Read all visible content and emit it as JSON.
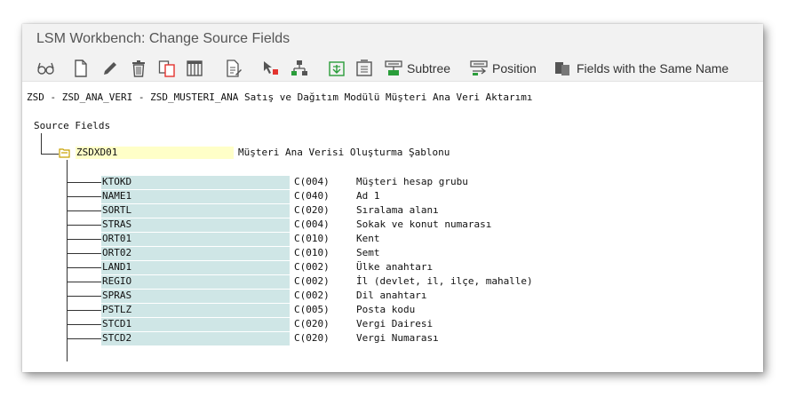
{
  "window": {
    "title": "LSM Workbench: Change Source Fields"
  },
  "toolbar": {
    "items": [
      {
        "icon": "glasses-icon"
      },
      {
        "icon": "new-document-icon"
      },
      {
        "icon": "pencil-icon"
      },
      {
        "icon": "trash-icon"
      },
      {
        "icon": "copy-icon"
      },
      {
        "icon": "table-icon"
      },
      {
        "icon": "document-edit-icon"
      },
      {
        "icon": "cursor-select-icon"
      },
      {
        "icon": "hierarchy-icon"
      },
      {
        "icon": "expand-icon"
      },
      {
        "icon": "collapse-icon"
      }
    ],
    "subtree_label": "Subtree",
    "position_label": "Position",
    "same_name_label": "Fields with the Same Name"
  },
  "header_line": "ZSD - ZSD_ANA_VERI - ZSD_MUSTERI_ANA Satış ve Dağıtım Modülü Müşteri Ana Veri Aktarımı",
  "tree": {
    "root_label": "Source Fields",
    "structure": {
      "name": "ZSDXD01",
      "description": "Müşteri Ana Verisi Oluşturma Şablonu"
    },
    "fields": [
      {
        "name": "KTOKD",
        "type": "C(004)",
        "description": "Müşteri hesap grubu"
      },
      {
        "name": "NAME1",
        "type": "C(040)",
        "description": "Ad 1"
      },
      {
        "name": "SORTL",
        "type": "C(020)",
        "description": "Sıralama alanı"
      },
      {
        "name": "STRAS",
        "type": "C(004)",
        "description": "Sokak ve konut numarası"
      },
      {
        "name": "ORT01",
        "type": "C(010)",
        "description": "Kent"
      },
      {
        "name": "ORT02",
        "type": "C(010)",
        "description": "Semt"
      },
      {
        "name": "LAND1",
        "type": "C(002)",
        "description": "Ülke anahtarı"
      },
      {
        "name": "REGIO",
        "type": "C(002)",
        "description": "İl (devlet, il, ilçe, mahalle)"
      },
      {
        "name": "SPRAS",
        "type": "C(002)",
        "description": "Dil anahtarı"
      },
      {
        "name": "PSTLZ",
        "type": "C(005)",
        "description": "Posta kodu"
      },
      {
        "name": "STCD1",
        "type": "C(020)",
        "description": "Vergi Dairesi"
      },
      {
        "name": "STCD2",
        "type": "C(020)",
        "description": "Vergi Numarası"
      }
    ]
  },
  "colors": {
    "structure_highlight": "#ffffc8",
    "field_highlight": "#cfe6e6",
    "folder_icon": "#c8a000"
  }
}
